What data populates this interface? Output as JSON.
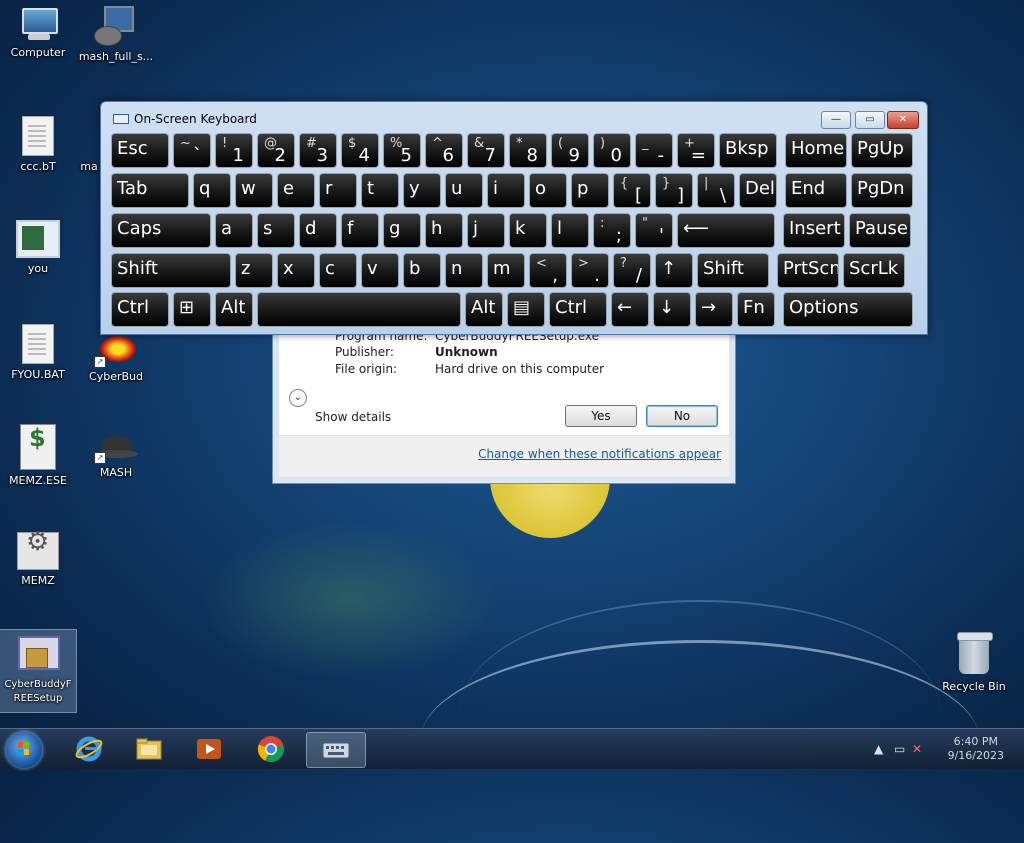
{
  "desktop": {
    "icons_left": [
      {
        "label": "Computer",
        "icon": "computer-icon"
      },
      {
        "label": "ccc.bT",
        "icon": "text-file-icon"
      },
      {
        "label": "you",
        "icon": "picture-file-icon"
      },
      {
        "label": "FYOU.BAT",
        "icon": "batch-file-icon"
      },
      {
        "label": "MEMZ.ESE",
        "icon": "script-file-icon"
      },
      {
        "label": "MEMZ",
        "icon": "settings-file-icon"
      },
      {
        "label": "CyberBuddyFREESetup",
        "icon": "setup-icon"
      }
    ],
    "icons_col2": [
      {
        "label": "mash_full_s...",
        "icon": "installer-icon"
      },
      {
        "label": "ma",
        "icon": "partial-icon"
      },
      {
        "label": "CyberBud",
        "icon": "cyberbud-icon"
      },
      {
        "label": "MASH",
        "icon": "mash-icon"
      }
    ],
    "recycle_bin": {
      "label": "Recycle Bin",
      "icon": "recycle-bin-icon"
    }
  },
  "osk": {
    "title": "On-Screen Keyboard",
    "rows": [
      [
        {
          "l": "Esc"
        },
        {
          "s": "~",
          "m": "`"
        },
        {
          "s": "!",
          "m": "1"
        },
        {
          "s": "@",
          "m": "2"
        },
        {
          "s": "#",
          "m": "3"
        },
        {
          "s": "$",
          "m": "4"
        },
        {
          "s": "%",
          "m": "5"
        },
        {
          "s": "^",
          "m": "6"
        },
        {
          "s": "&",
          "m": "7"
        },
        {
          "s": "*",
          "m": "8"
        },
        {
          "s": "(",
          "m": "9"
        },
        {
          "s": ")",
          "m": "0"
        },
        {
          "s": "_",
          "m": "-"
        },
        {
          "s": "+",
          "m": "="
        },
        {
          "l": "Bksp"
        },
        {
          "l": "Home"
        },
        {
          "l": "PgUp"
        }
      ],
      [
        {
          "l": "Tab"
        },
        {
          "l": "q"
        },
        {
          "l": "w"
        },
        {
          "l": "e"
        },
        {
          "l": "r"
        },
        {
          "l": "t"
        },
        {
          "l": "y"
        },
        {
          "l": "u"
        },
        {
          "l": "i"
        },
        {
          "l": "o"
        },
        {
          "l": "p"
        },
        {
          "s": "{",
          "m": "["
        },
        {
          "s": "}",
          "m": "]"
        },
        {
          "s": "|",
          "m": "\\"
        },
        {
          "l": "Del"
        },
        {
          "l": "End"
        },
        {
          "l": "PgDn"
        }
      ],
      [
        {
          "l": "Caps"
        },
        {
          "l": "a"
        },
        {
          "l": "s"
        },
        {
          "l": "d"
        },
        {
          "l": "f"
        },
        {
          "l": "g"
        },
        {
          "l": "h"
        },
        {
          "l": "j"
        },
        {
          "l": "k"
        },
        {
          "l": "l"
        },
        {
          "s": ":",
          "m": ";"
        },
        {
          "s": "\"",
          "m": "'"
        },
        {
          "l": "⟵"
        },
        {
          "l": "Insert"
        },
        {
          "l": "Pause"
        }
      ],
      [
        {
          "l": "Shift"
        },
        {
          "l": "z"
        },
        {
          "l": "x"
        },
        {
          "l": "c"
        },
        {
          "l": "v"
        },
        {
          "l": "b"
        },
        {
          "l": "n"
        },
        {
          "l": "m"
        },
        {
          "s": "<",
          "m": ","
        },
        {
          "s": ">",
          "m": "."
        },
        {
          "s": "?",
          "m": "/"
        },
        {
          "l": "↑"
        },
        {
          "l": "Shift"
        },
        {
          "l": "PrtScn"
        },
        {
          "l": "ScrLk"
        }
      ],
      [
        {
          "l": "Ctrl"
        },
        {
          "l": "⊞"
        },
        {
          "l": "Alt"
        },
        {
          "l": ""
        },
        {
          "l": "Alt"
        },
        {
          "l": "▤"
        },
        {
          "l": "Ctrl"
        },
        {
          "l": "←"
        },
        {
          "l": "↓"
        },
        {
          "l": "→"
        },
        {
          "l": "Fn"
        },
        {
          "l": "Options"
        }
      ]
    ]
  },
  "uac": {
    "program_name_label": "Program name:",
    "program_name_value": "CyberBuddyFREESetup.exe",
    "publisher_label": "Publisher:",
    "publisher_value": "Unknown",
    "origin_label": "File origin:",
    "origin_value": "Hard drive on this computer",
    "show_details": "Show details",
    "yes": "Yes",
    "no": "No",
    "link": "Change when these notifications appear"
  },
  "taskbar": {
    "items": [
      {
        "icon": "internet-explorer-icon"
      },
      {
        "icon": "file-explorer-icon"
      },
      {
        "icon": "media-player-icon"
      },
      {
        "icon": "chrome-icon"
      },
      {
        "icon": "on-screen-keyboard-icon",
        "active": true
      }
    ],
    "time": "6:40 PM",
    "date": "9/16/2023"
  }
}
